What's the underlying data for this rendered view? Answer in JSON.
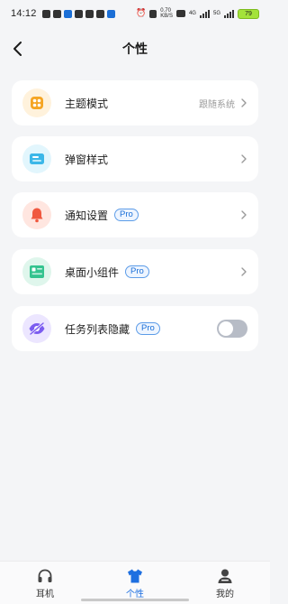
{
  "status_bar": {
    "time": "14:12",
    "speed_top": "0.70",
    "speed_bottom": "KB/S",
    "network_a": "4G",
    "network_b": "5G",
    "battery": "79"
  },
  "header": {
    "title": "个性"
  },
  "settings": [
    {
      "label": "主题模式",
      "value": "跟随系统",
      "pro": "",
      "icon": "theme-palette-icon",
      "icon_color": "#f5a524",
      "icon_bg": "#fff2dc"
    },
    {
      "label": "弹窗样式",
      "value": "",
      "pro": "",
      "icon": "popup-window-icon",
      "icon_color": "#3cb7e8",
      "icon_bg": "#e2f6fd"
    },
    {
      "label": "通知设置",
      "value": "",
      "pro": "Pro",
      "icon": "notification-bell-icon",
      "icon_color": "#f0583f",
      "icon_bg": "#ffe6e0"
    },
    {
      "label": "桌面小组件",
      "value": "",
      "pro": "Pro",
      "icon": "desktop-widget-icon",
      "icon_color": "#34c38f",
      "icon_bg": "#dff6ec"
    },
    {
      "label": "任务列表隐藏",
      "value": "",
      "pro": "Pro",
      "icon": "hidden-eye-icon",
      "icon_color": "#7b5cf0",
      "icon_bg": "#ece6ff",
      "toggle_on": false
    }
  ],
  "bottom_nav": {
    "items": [
      {
        "label": "耳机",
        "icon": "headphones-icon",
        "active": false
      },
      {
        "label": "个性",
        "icon": "tshirt-icon",
        "active": true
      },
      {
        "label": "我的",
        "icon": "profile-icon",
        "active": false
      }
    ],
    "active_color": "#1d6fe0"
  }
}
